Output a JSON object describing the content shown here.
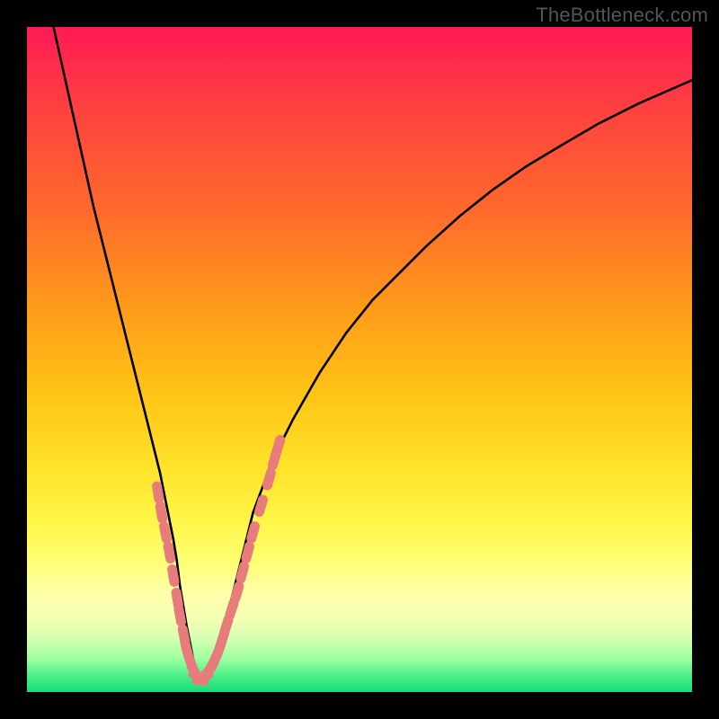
{
  "watermark": "TheBottleneck.com",
  "chart_data": {
    "type": "line",
    "title": "",
    "xlabel": "",
    "ylabel": "",
    "xlim": [
      0,
      100
    ],
    "ylim": [
      0,
      100
    ],
    "curve": {
      "name": "bottleneck-curve",
      "x": [
        4,
        6,
        8,
        10,
        12,
        14,
        15,
        16,
        17,
        18,
        19,
        20,
        21,
        22,
        22.5,
        23,
        24,
        25,
        25.5,
        26,
        27,
        28,
        29,
        30,
        31,
        32,
        33,
        34,
        35.5,
        37,
        40,
        44,
        48,
        52,
        56,
        60,
        65,
        70,
        75,
        80,
        86,
        92,
        100
      ],
      "y_pct": [
        100,
        91,
        82,
        73,
        65,
        57,
        53,
        49,
        45,
        41,
        37,
        33,
        28,
        23,
        20,
        16,
        10,
        5,
        3,
        2,
        2.5,
        4,
        7,
        11,
        15,
        19,
        23,
        27,
        31,
        35,
        41,
        48,
        54,
        59,
        63,
        67,
        71.5,
        75.5,
        79,
        82,
        85.5,
        88.5,
        92
      ]
    },
    "highlight_points": {
      "name": "highlight-dots",
      "color": "#e87b7b",
      "points": [
        {
          "x": 19.7,
          "y_pct": 30
        },
        {
          "x": 20.2,
          "y_pct": 27
        },
        {
          "x": 20.8,
          "y_pct": 24
        },
        {
          "x": 21.4,
          "y_pct": 21
        },
        {
          "x": 22.0,
          "y_pct": 17.5
        },
        {
          "x": 22.6,
          "y_pct": 14
        },
        {
          "x": 23.0,
          "y_pct": 11.5
        },
        {
          "x": 23.6,
          "y_pct": 8.5
        },
        {
          "x": 24.0,
          "y_pct": 6.5
        },
        {
          "x": 24.6,
          "y_pct": 4.5
        },
        {
          "x": 25.2,
          "y_pct": 3
        },
        {
          "x": 25.8,
          "y_pct": 2.2
        },
        {
          "x": 26.4,
          "y_pct": 2.2
        },
        {
          "x": 27.0,
          "y_pct": 2.8
        },
        {
          "x": 27.6,
          "y_pct": 3.6
        },
        {
          "x": 28.2,
          "y_pct": 4.8
        },
        {
          "x": 28.8,
          "y_pct": 6.2
        },
        {
          "x": 29.4,
          "y_pct": 8
        },
        {
          "x": 30.0,
          "y_pct": 10
        },
        {
          "x": 30.8,
          "y_pct": 12.5
        },
        {
          "x": 31.6,
          "y_pct": 15
        },
        {
          "x": 32.4,
          "y_pct": 18
        },
        {
          "x": 33.2,
          "y_pct": 21
        },
        {
          "x": 34.0,
          "y_pct": 24
        },
        {
          "x": 35.2,
          "y_pct": 28
        },
        {
          "x": 36.4,
          "y_pct": 32
        },
        {
          "x": 37.2,
          "y_pct": 35
        },
        {
          "x": 37.8,
          "y_pct": 37
        }
      ]
    },
    "gradient_stops": [
      {
        "pos": 0.0,
        "color": "#ff1a54"
      },
      {
        "pos": 0.12,
        "color": "#ff4040"
      },
      {
        "pos": 0.28,
        "color": "#ff6b2b"
      },
      {
        "pos": 0.42,
        "color": "#ff9a1a"
      },
      {
        "pos": 0.55,
        "color": "#ffc316"
      },
      {
        "pos": 0.66,
        "color": "#ffe22a"
      },
      {
        "pos": 0.74,
        "color": "#fff546"
      },
      {
        "pos": 0.8,
        "color": "#ffff70"
      },
      {
        "pos": 0.85,
        "color": "#ffffa8"
      },
      {
        "pos": 0.89,
        "color": "#f4ffb4"
      },
      {
        "pos": 0.92,
        "color": "#d4ffb0"
      },
      {
        "pos": 0.95,
        "color": "#9effa0"
      },
      {
        "pos": 0.975,
        "color": "#4cf08a"
      },
      {
        "pos": 1.0,
        "color": "#17db77"
      }
    ]
  }
}
